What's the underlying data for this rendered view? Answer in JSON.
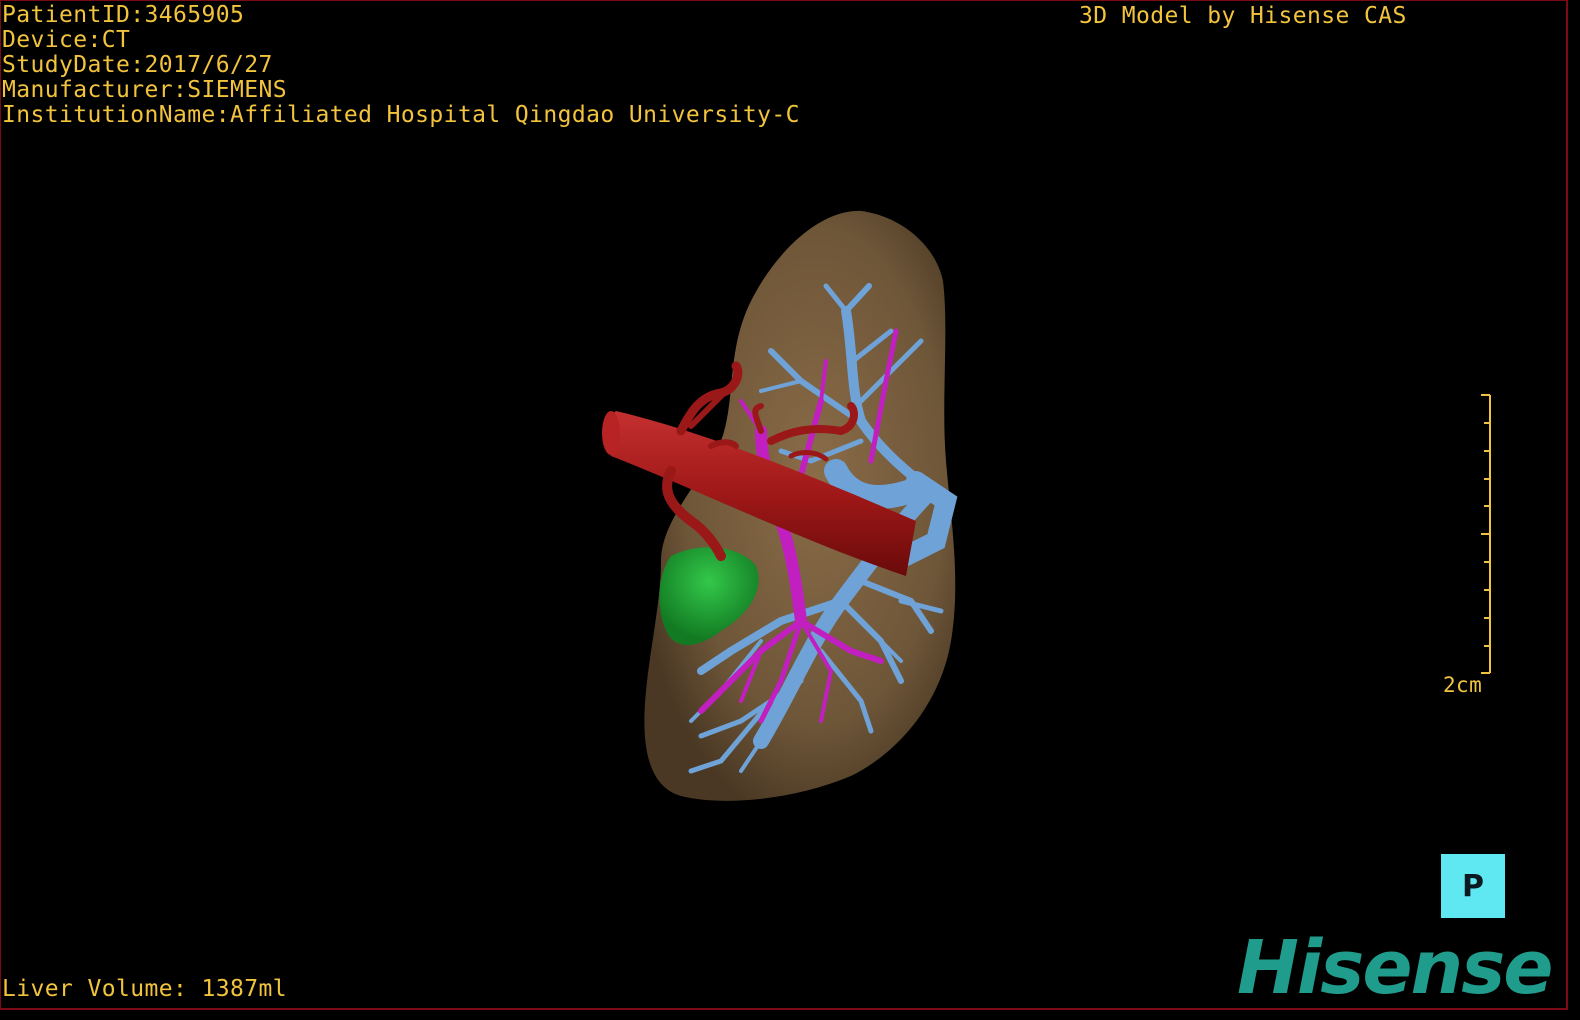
{
  "study_info": {
    "patient_id": "PatientID:3465905",
    "device": "Device:CT",
    "study_date": "StudyDate:2017/6/27",
    "manufacturer": "Manufacturer:SIEMENS",
    "institution": "InstitutionName:Affiliated Hospital Qingdao University-C"
  },
  "credit": "3D Model by Hisense CAS",
  "liver_volume": "Liver Volume: 1387ml",
  "scale": {
    "label": "2cm"
  },
  "orientation_cube": {
    "label": "P"
  },
  "brand": {
    "logo_text": "Hisense"
  },
  "colors": {
    "overlay_text": "#f2c33d",
    "liver": "#7a6040",
    "portal_vein": "#6fa3d8",
    "artery": "#a51c1c",
    "hepatic_vein": "#c21fc0",
    "gallbladder": "#1fa032",
    "orientation_cube": "#5fe8f2",
    "brand": "#1f9c8c"
  }
}
